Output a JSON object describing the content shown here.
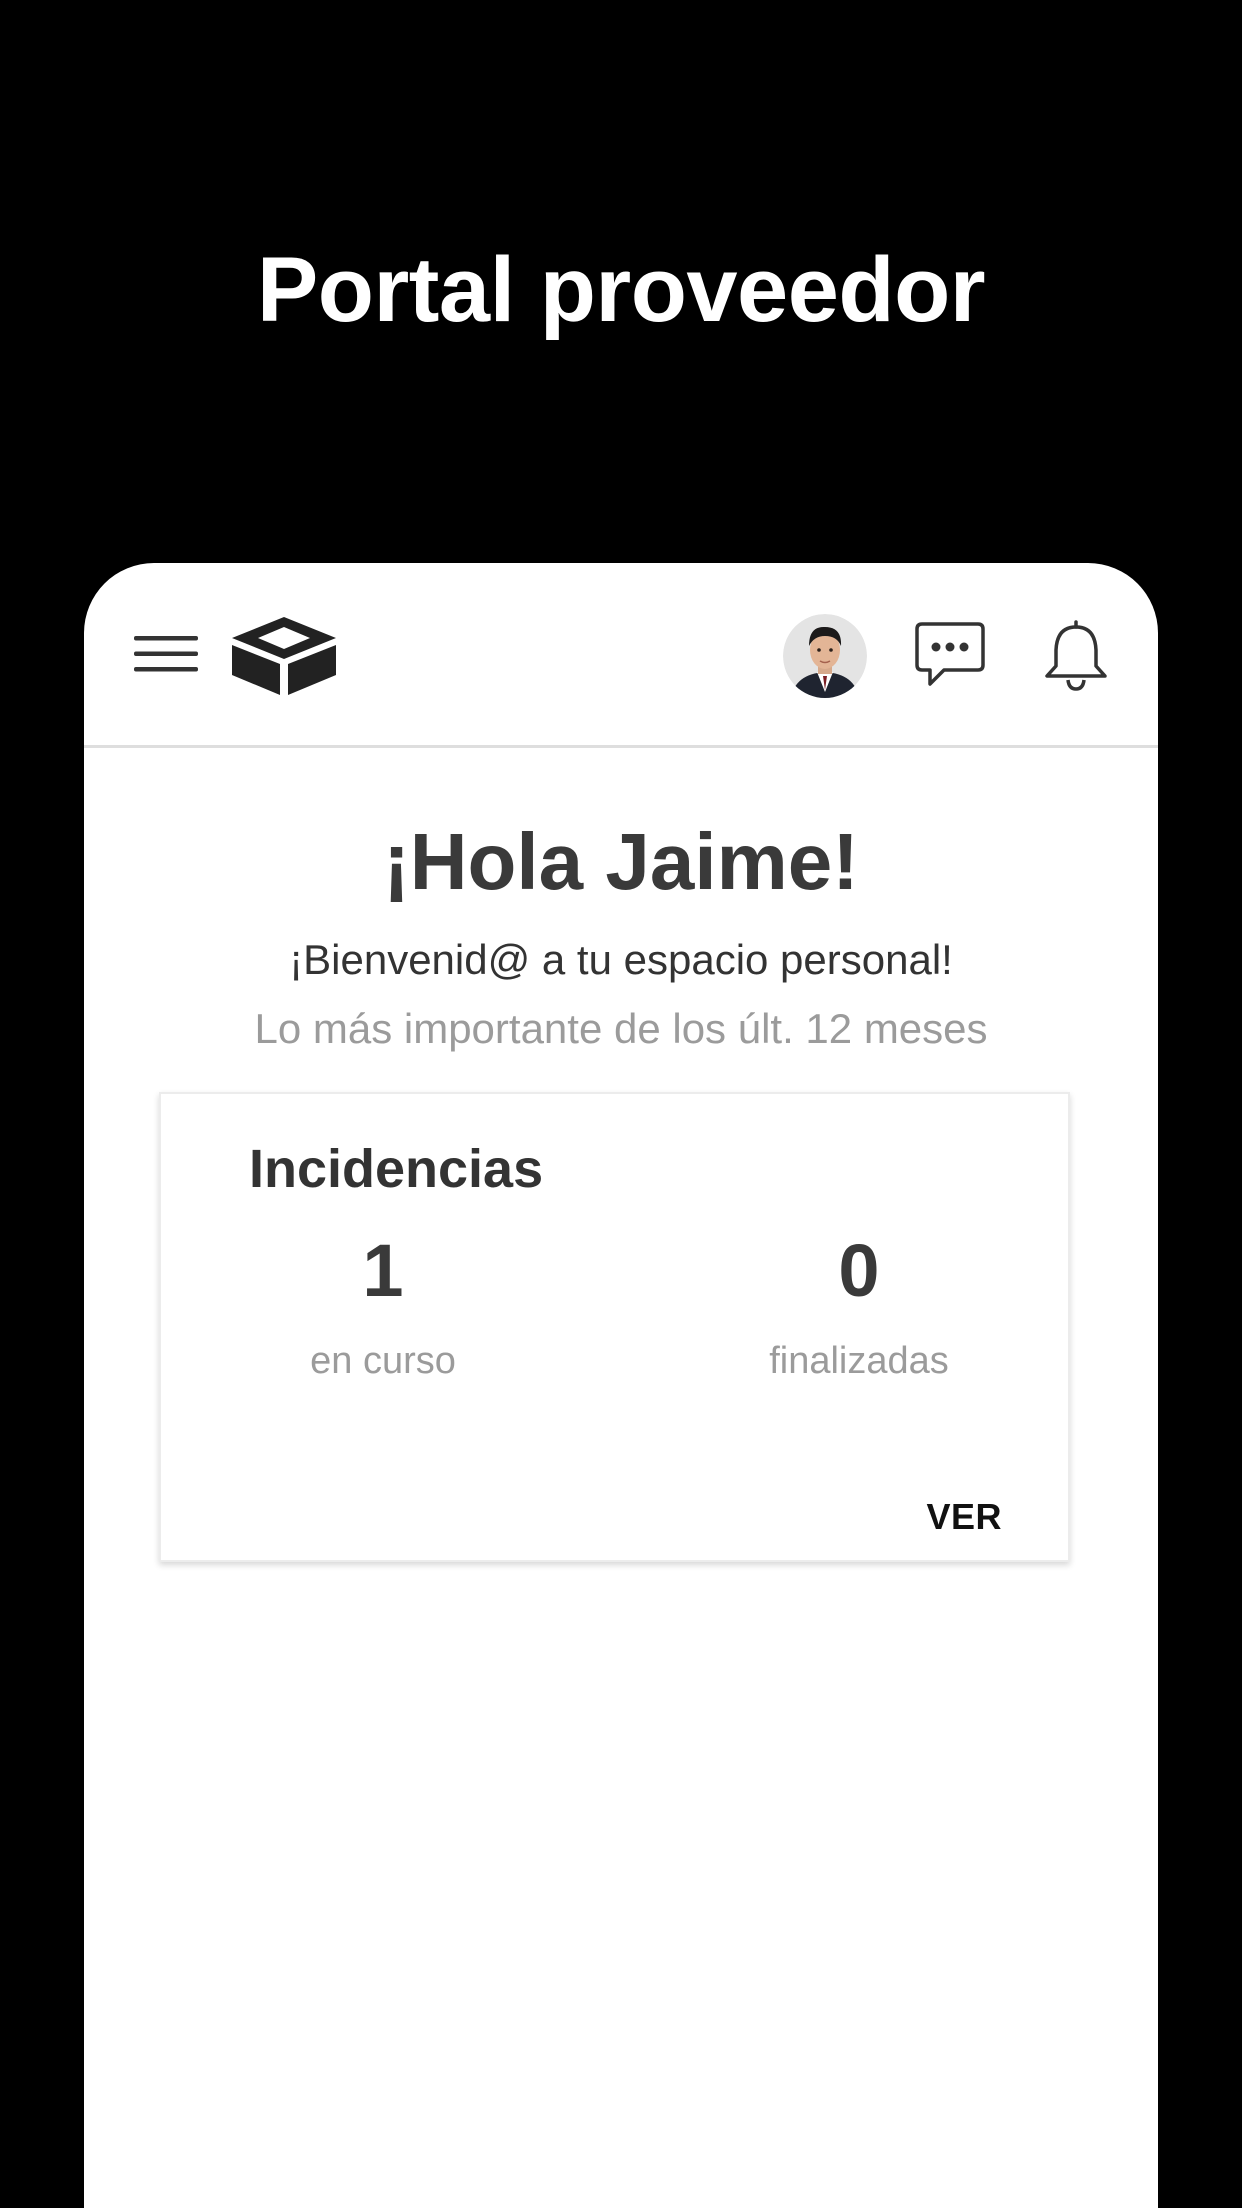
{
  "promo": {
    "title": "Portal proveedor"
  },
  "app_bar": {
    "menu_icon": "hamburger-menu-icon",
    "logo_icon": "box-logo-icon",
    "avatar": "user-avatar",
    "chat_icon": "chat-bubble-icon",
    "bell_icon": "bell-icon"
  },
  "home": {
    "greeting": "¡Hola Jaime!",
    "welcome": "¡Bienvenid@ a tu espacio personal!",
    "subtitle": "Lo más importante de los últ. 12 meses"
  },
  "incidencias_card": {
    "title": "Incidencias",
    "in_progress_value": "1",
    "in_progress_label": "en curso",
    "finished_value": "0",
    "finished_label": "finalizadas",
    "action_label": "VER"
  },
  "colors": {
    "background": "#000000",
    "surface": "#ffffff",
    "text_primary": "#3a3a3a",
    "text_secondary": "#9b9b9b"
  }
}
